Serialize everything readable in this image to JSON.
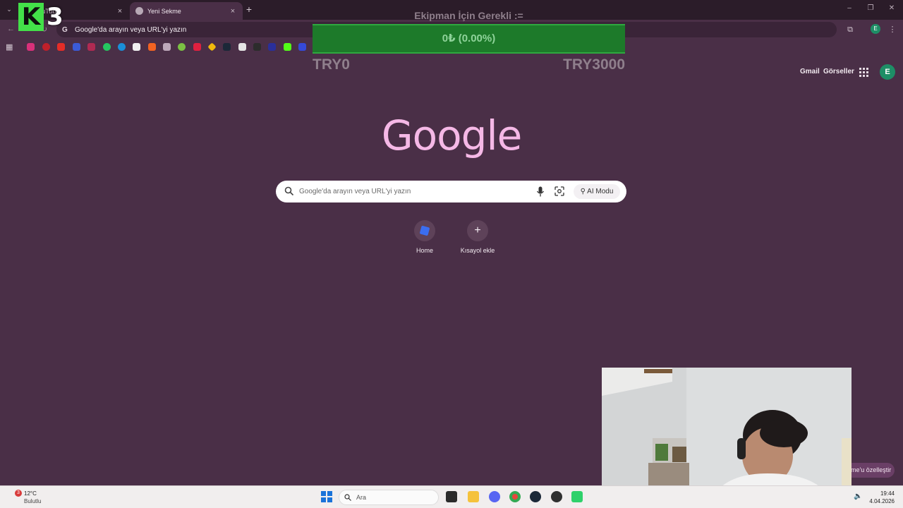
{
  "browser": {
    "tabs": [
      {
        "label": "YouTube",
        "active": false
      },
      {
        "label": "Yeni Sekme",
        "active": true
      }
    ],
    "omnibox_text": "Google'da arayın veya URL'yi yazın",
    "profile_initial": "E"
  },
  "overlay": {
    "logo_letter": "K",
    "logo_number": "3",
    "goal_title": "Ekipman İçin Gerekli :=",
    "goal_value": "0₺ (0.00%)",
    "goal_progress": 0.0,
    "goal_min": "TRY0",
    "goal_max": "TRY3000"
  },
  "ntp": {
    "links": {
      "gmail": "Gmail",
      "images": "Görseller"
    },
    "avatar_initial": "E",
    "logo_text": "Google",
    "search_placeholder": "Google'da arayın veya URL'yi yazın",
    "ai_mode": "AI Modu",
    "shortcuts": [
      {
        "label": "Home",
        "icon": "home-app-icon"
      },
      {
        "label": "Kısayol ekle",
        "icon": "plus-icon"
      }
    ],
    "customize_label": "me'u özelleştir"
  },
  "taskbar": {
    "weather_temp": "12°C",
    "weather_desc": "Bulutlu",
    "weather_badge": "3",
    "search_label": "Ara",
    "time": "19:44",
    "date": "4.04.2026"
  },
  "colors": {
    "page_bg": "#4a2f47",
    "logo": "#f5b8e6",
    "goal_bar": "#1d7a2a"
  }
}
